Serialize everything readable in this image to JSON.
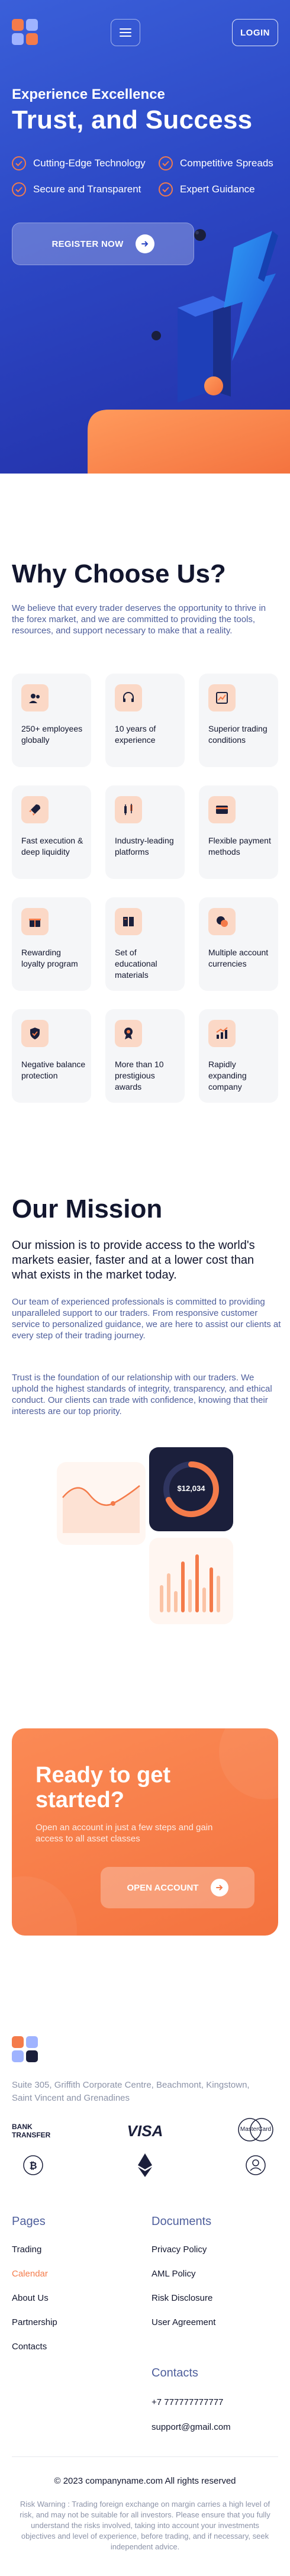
{
  "header": {
    "login_label": "LOGIN"
  },
  "hero": {
    "subtitle": "Experience Excellence",
    "title": "Trust, and Success",
    "features": [
      "Cutting-Edge Technology",
      "Competitive Spreads",
      "Secure and Transparent",
      "Expert Guidance"
    ],
    "register_label": "REGISTER NOW"
  },
  "why": {
    "title": "Why Choose Us?",
    "description": "We believe that every trader deserves the opportunity to thrive in the forex market, and we are committed to providing the tools, resources, and support necessary to make that a reality.",
    "cards": [
      {
        "label": "250+ employees globally",
        "icon": "users-icon"
      },
      {
        "label": "10 years of experience",
        "icon": "headset-icon"
      },
      {
        "label": "Superior trading conditions",
        "icon": "chart-icon"
      },
      {
        "label": "Fast execution & deep liquidity",
        "icon": "rocket-icon"
      },
      {
        "label": "Industry-leading platforms",
        "icon": "candles-icon"
      },
      {
        "label": "Flexible payment methods",
        "icon": "card-icon"
      },
      {
        "label": "Rewarding loyalty program",
        "icon": "gift-icon"
      },
      {
        "label": "Set of educational materials",
        "icon": "book-icon"
      },
      {
        "label": "Multiple account currencies",
        "icon": "coins-icon"
      },
      {
        "label": "Negative balance protection",
        "icon": "shield-icon"
      },
      {
        "label": "More than 10 prestigious awards",
        "icon": "award-icon"
      },
      {
        "label": "Rapidly expanding company",
        "icon": "growth-icon"
      }
    ]
  },
  "mission": {
    "title": "Our Mission",
    "lead": "Our mission is to provide access to the world's markets easier, faster and at a lower cost than what exists in the market today.",
    "p1": "Our team of experienced professionals is committed to providing unparalleled support to our traders. From responsive customer service to personalized guidance, we are here to assist our clients at every step of their trading journey.",
    "p2": "Trust is the foundation of our relationship with our traders. We uphold the highest standards of integrity, transparency, and ethical conduct. Our clients can trade with confidence, knowing that their interests are our top priority.",
    "balance": "$12,034"
  },
  "cta": {
    "title": "Ready to get started?",
    "subtitle": "Open an account in just a few steps and gain access to all asset classes",
    "button": "OPEN ACCOUNT"
  },
  "footer": {
    "address": "Suite 305, Griffith Corporate Centre, Beachmont, Kingstown, Saint Vincent and Grenadines",
    "payments": {
      "bank1": "BANK",
      "bank2": "TRANSFER",
      "visa": "VISA",
      "mastercard": "MasterCard"
    },
    "pages_title": "Pages",
    "pages": [
      "Trading",
      "Calendar",
      "About Us",
      "Partnership",
      "Contacts"
    ],
    "documents_title": "Documents",
    "documents": [
      "Privacy Policy",
      "AML Policy",
      "Risk Disclosure",
      "User Agreement"
    ],
    "contacts_title": "Contacts",
    "phone": "+7 777777777777",
    "email": "support@gmail.com",
    "copyright": "© 2023 companyname.com All rights reserved",
    "risk": "Risk Warning : Trading foreign exchange on margin carries a high level of risk, and may not be suitable for all investors. Please ensure that you fully understand the risks involved, taking into account your investments objectives and level of experience, before trading, and if necessary, seek independent advice."
  },
  "colors": {
    "primary": "#2c47c4",
    "accent": "#f47b4a",
    "text": "#12162e",
    "muted": "#4f5f9c"
  }
}
